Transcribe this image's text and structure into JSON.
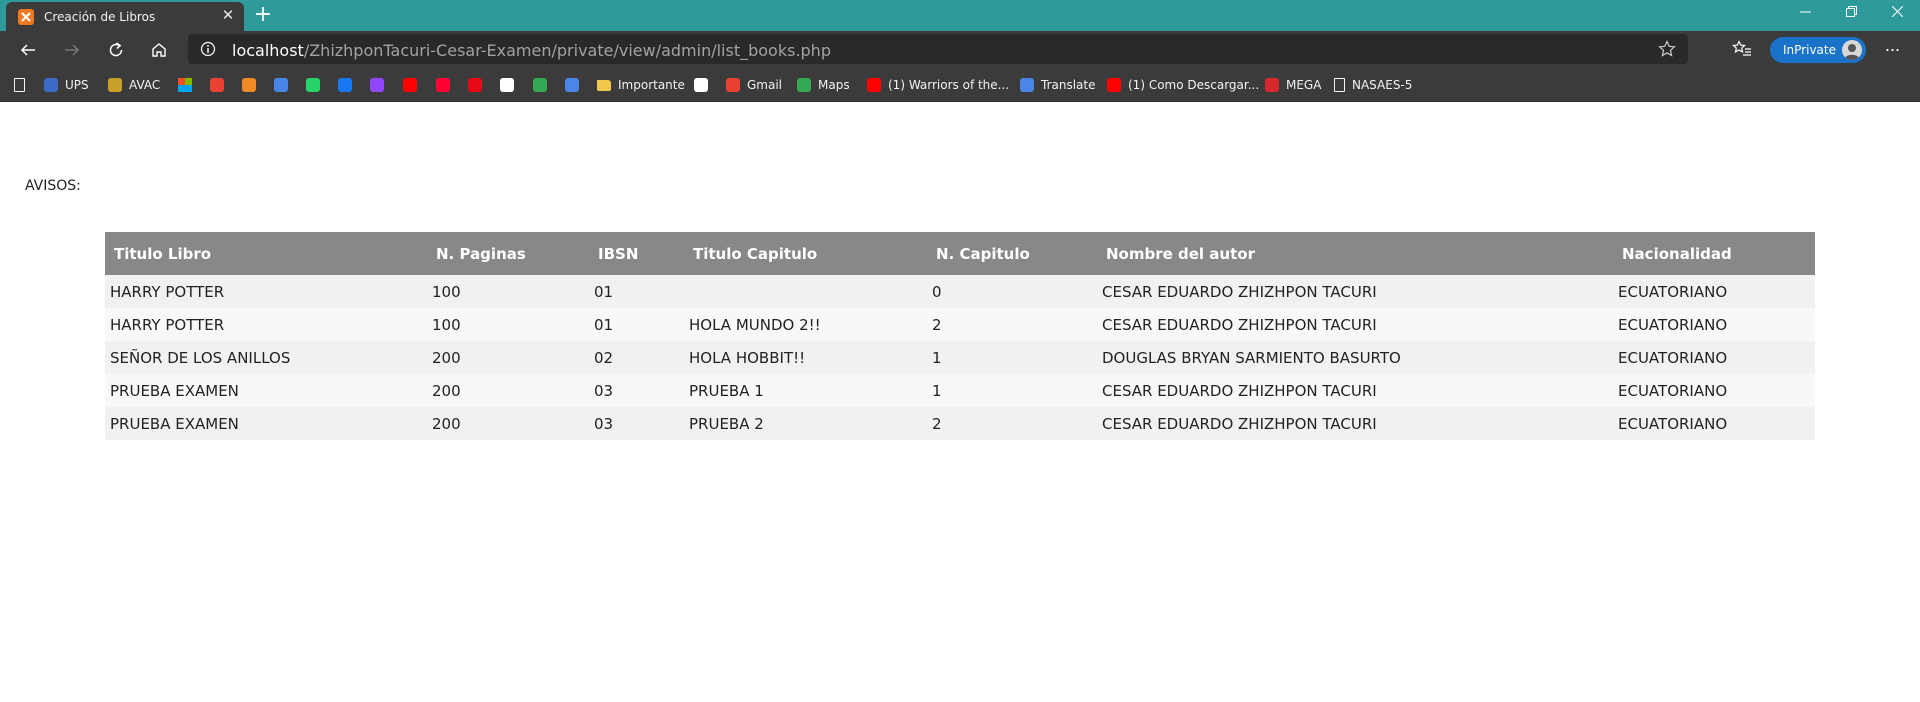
{
  "browser": {
    "tab": {
      "title": "Creación de Libros"
    },
    "newtab_label": "+",
    "address": {
      "host": "localhost",
      "path": "/ZhizhponTacuri-Cesar-Examen/private/view/admin/list_books.php"
    },
    "inprivate_label": "InPrivate",
    "more_label": "···"
  },
  "bookmarks": [
    {
      "label": "",
      "icon": "page-icon",
      "color": "#3b3b3b"
    },
    {
      "label": "UPS",
      "icon": "ups-icon",
      "color": "#3b6bc6"
    },
    {
      "label": "AVAC",
      "icon": "avac-icon",
      "color": "#c8a028"
    },
    {
      "label": "",
      "icon": "microsoft-icon",
      "color": "#f25022"
    },
    {
      "label": "",
      "icon": "gmail-icon",
      "color": "#e94235"
    },
    {
      "label": "",
      "icon": "slides-icon",
      "color": "#f08a24"
    },
    {
      "label": "",
      "icon": "translate-icon",
      "color": "#4a86e8"
    },
    {
      "label": "",
      "icon": "whatsapp-icon",
      "color": "#25d366"
    },
    {
      "label": "",
      "icon": "facebook-icon",
      "color": "#1877f2"
    },
    {
      "label": "",
      "icon": "twitch-icon",
      "color": "#9146ff"
    },
    {
      "label": "",
      "icon": "youtube-icon",
      "color": "#ff0000"
    },
    {
      "label": "",
      "icon": "youtube-music-icon",
      "color": "#ff0033"
    },
    {
      "label": "",
      "icon": "netflix-icon",
      "color": "#e50914"
    },
    {
      "label": "",
      "icon": "amazon-icon",
      "color": "#ffffff"
    },
    {
      "label": "",
      "icon": "maps-icon",
      "color": "#34a853"
    },
    {
      "label": "",
      "icon": "translate-icon",
      "color": "#4a86e8"
    },
    {
      "label": "Importante",
      "icon": "folder-icon",
      "color": "#f2c94c"
    },
    {
      "label": "",
      "icon": "google-icon",
      "color": "#ffffff"
    },
    {
      "label": "Gmail",
      "icon": "gmail-icon",
      "color": "#e94235"
    },
    {
      "label": "Maps",
      "icon": "maps-icon",
      "color": "#34a853"
    },
    {
      "label": "(1) Warriors of the...",
      "icon": "youtube-icon",
      "color": "#ff0000"
    },
    {
      "label": "Translate",
      "icon": "translate-icon",
      "color": "#4a86e8"
    },
    {
      "label": "(1) Como Descargar...",
      "icon": "youtube-icon",
      "color": "#ff0000"
    },
    {
      "label": "MEGA",
      "icon": "mega-icon",
      "color": "#d9272e"
    },
    {
      "label": "NASAES-5",
      "icon": "page-icon",
      "color": "#3b3b3b"
    }
  ],
  "page": {
    "avisos_label": "AVISOS:",
    "table": {
      "headers": [
        "Titulo Libro",
        "N. Paginas",
        "IBSN",
        "Titulo Capitulo",
        "N. Capitulo",
        "Nombre del autor",
        "Nacionalidad"
      ],
      "rows": [
        [
          "HARRY POTTER",
          "100",
          "01",
          "",
          "0",
          "CESAR EDUARDO ZHIZHPON TACURI",
          "ECUATORIANO"
        ],
        [
          "HARRY POTTER",
          "100",
          "01",
          "HOLA MUNDO 2!!",
          "2",
          "CESAR EDUARDO ZHIZHPON TACURI",
          "ECUATORIANO"
        ],
        [
          "SEÑOR DE LOS ANILLOS",
          "200",
          "02",
          "HOLA HOBBIT!!",
          "1",
          "DOUGLAS BRYAN SARMIENTO BASURTO",
          "ECUATORIANO"
        ],
        [
          "PRUEBA EXAMEN",
          "200",
          "03",
          "PRUEBA 1",
          "1",
          "CESAR EDUARDO ZHIZHPON TACURI",
          "ECUATORIANO"
        ],
        [
          "PRUEBA EXAMEN",
          "200",
          "03",
          "PRUEBA 2",
          "2",
          "CESAR EDUARDO ZHIZHPON TACURI",
          "ECUATORIANO"
        ]
      ]
    }
  },
  "colors": {
    "tabstrip": "#2e9a9b",
    "chrome": "#3b3b3b",
    "table_header": "#888888",
    "inprivate": "#1a73c8"
  }
}
